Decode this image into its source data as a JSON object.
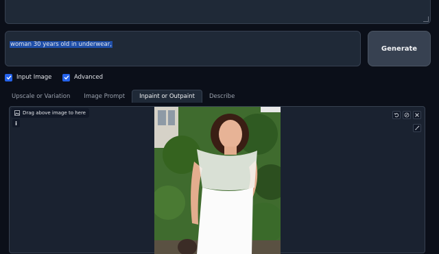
{
  "prompt": {
    "value": "woman 30 years old in underwear,"
  },
  "generate_button": {
    "label": "Generate"
  },
  "options": {
    "input_image": {
      "label": "Input Image",
      "checked": true
    },
    "advanced": {
      "label": "Advanced",
      "checked": true
    }
  },
  "tabs": [
    {
      "label": "Upscale or Variation",
      "active": false
    },
    {
      "label": "Image Prompt",
      "active": false
    },
    {
      "label": "Inpaint or Outpaint",
      "active": true
    },
    {
      "label": "Describe",
      "active": false
    }
  ],
  "image_panel": {
    "drag_hint": "Drag above image to here",
    "info_label": "i"
  },
  "colors": {
    "background": "#0b0f19",
    "panel": "#1f2937",
    "accent": "#2563eb",
    "selection": "#1e4ea8"
  },
  "icons": [
    "image-icon",
    "undo-icon",
    "edit-icon",
    "close-icon",
    "brush-icon",
    "check-icon"
  ]
}
